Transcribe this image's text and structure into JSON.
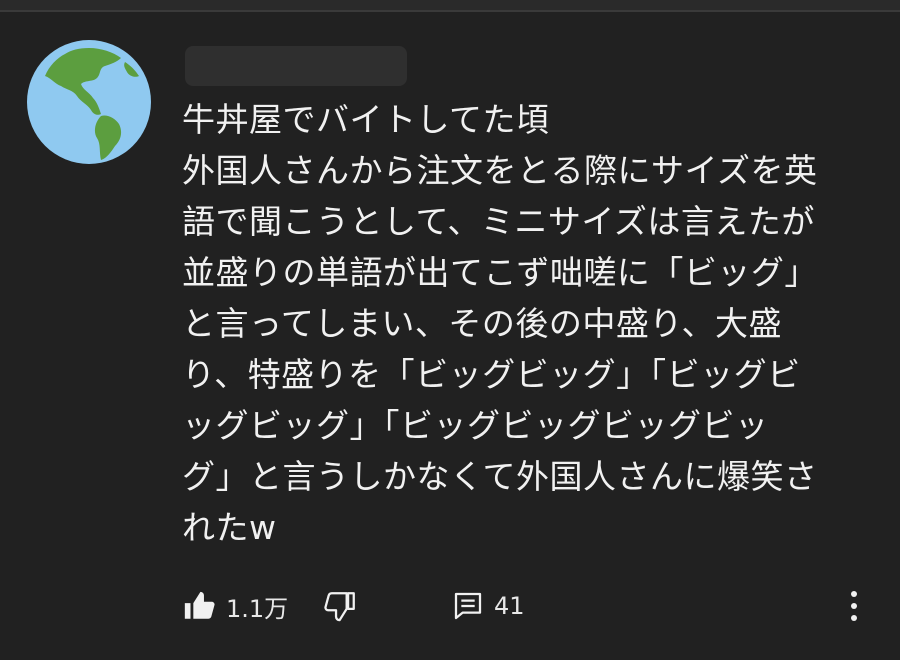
{
  "comment": {
    "lines": [
      "牛丼屋でバイトしてた頃",
      "外国人さんから注文をとる際にサイズを英",
      "語で聞こうとして、ミニサイズは言えたが",
      "並盛りの単語が出てこず咄嗟に「ビッグ」",
      "と言ってしまい、その後の中盛り、大盛",
      "り、特盛りを「ビッグビッグ」「ビッグビ",
      "ッグビッグ」「ビッグビッグビッグビッ",
      "グ」と言うしかなくて外国人さんに爆笑さ",
      "れたw"
    ]
  },
  "actions": {
    "like_count": "1.1万",
    "reply_count": "41"
  },
  "icons": {
    "avatar": "earth-globe-icon",
    "like": "thumbs-up-filled-icon",
    "dislike": "thumbs-down-outline-icon",
    "reply": "comment-icon",
    "more": "more-vertical-icon"
  },
  "colors": {
    "background": "#212121",
    "text": "#f1f1f1",
    "ocean": "#8fc9f0",
    "land": "#5c9e3f"
  }
}
